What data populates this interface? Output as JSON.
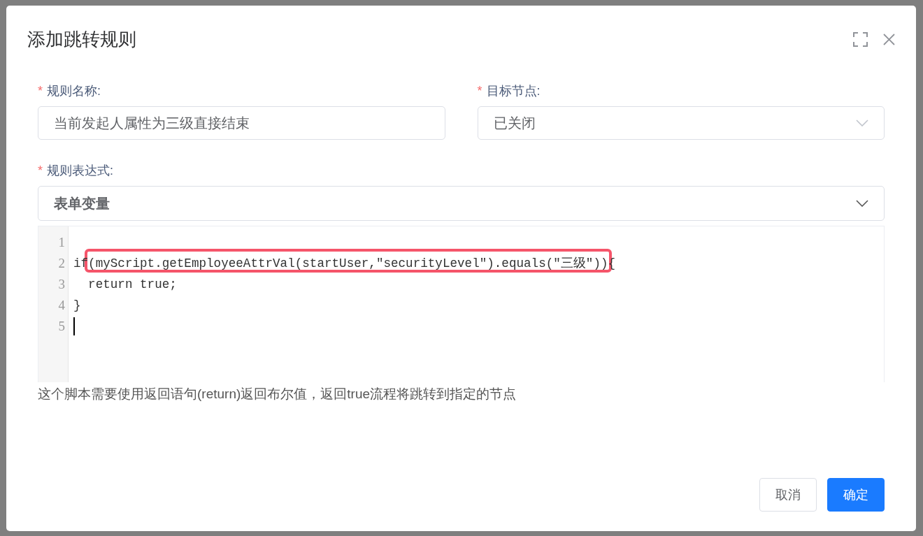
{
  "dialog": {
    "title": "添加跳转规则"
  },
  "fields": [
    {
      "required_mark": "*",
      "label": "规则名称:",
      "kind": "input",
      "value": "当前发起人属性为三级直接结束"
    },
    {
      "required_mark": "*",
      "label": "目标节点:",
      "kind": "select",
      "value": "已关闭"
    }
  ],
  "expression": {
    "required_mark": "*",
    "label": "规则表达式:",
    "variable_select": "表单变量",
    "code_lines": [
      {
        "number": "1"
      },
      {
        "number": "2",
        "text": "if(myScript.getEmployeeAttrVal(startUser,\"securityLevel\").equals(\"三级\")){",
        "highlighted": true
      },
      {
        "number": "3",
        "text": "  return true;"
      },
      {
        "number": "4",
        "text": "}"
      },
      {
        "number": "5",
        "cursor": true
      }
    ],
    "help": "这个脚本需要使用返回语句(return)返回布尔值，返回true流程将跳转到指定的节点"
  },
  "buttons": [
    {
      "label": "取消",
      "kind": "default"
    },
    {
      "label": "确定",
      "kind": "primary"
    }
  ]
}
